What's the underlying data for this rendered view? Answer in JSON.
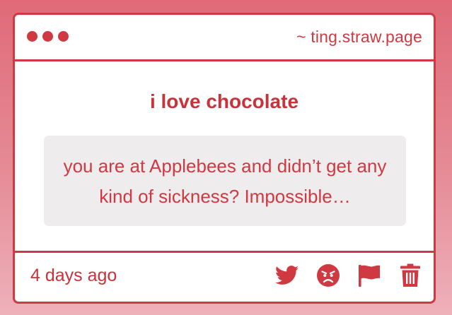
{
  "header": {
    "site": "~ ting.straw.page",
    "dots_color": "#cf3941"
  },
  "post": {
    "title": "i love chocolate",
    "message": "you are at Applebees and didn’t get any kind of sickness? Impossible…"
  },
  "footer": {
    "time": "4 days ago",
    "actions": [
      {
        "icon": "twitter-icon"
      },
      {
        "icon": "angry-face-icon"
      },
      {
        "icon": "flag-icon"
      },
      {
        "icon": "trash-icon"
      }
    ]
  },
  "colors": {
    "accent": "#cf3941",
    "message_bg": "#eeeced",
    "background_top": "#e06a78",
    "background_bottom": "#eeb1ba"
  }
}
